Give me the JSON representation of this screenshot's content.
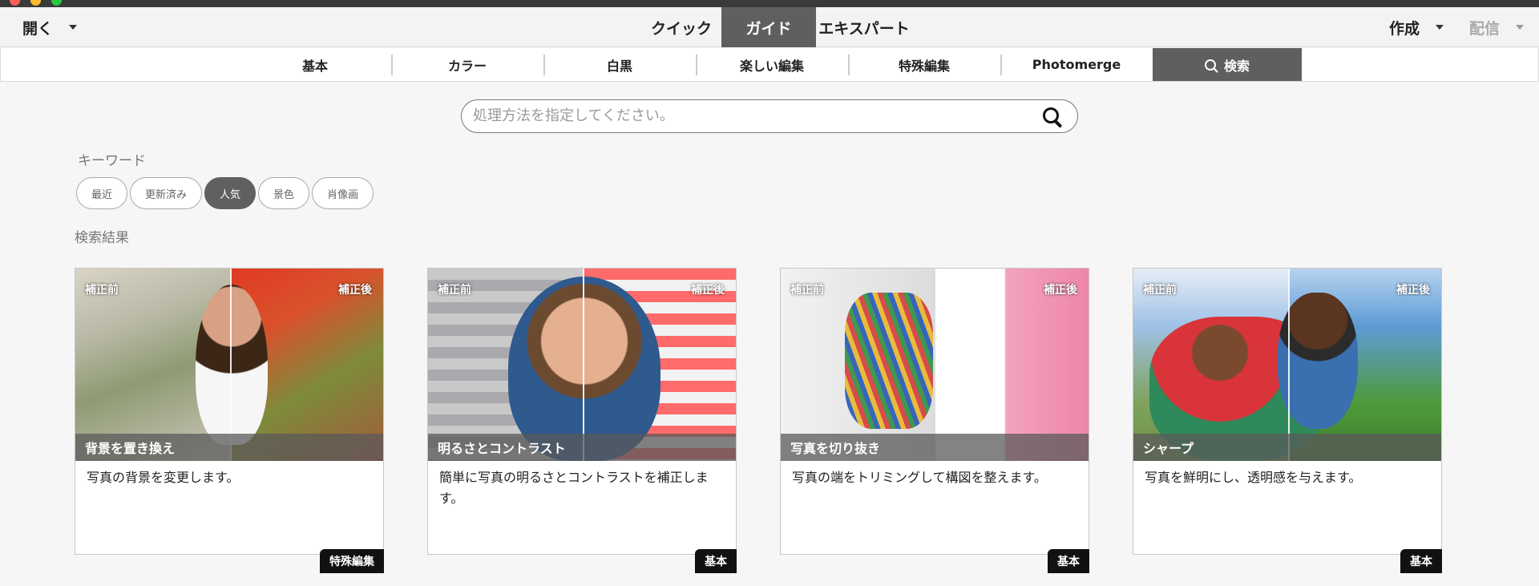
{
  "topbar": {
    "open_label": "開く",
    "modes": [
      "クイック",
      "ガイド",
      "エキスパート"
    ],
    "active_mode": "ガイド",
    "create_label": "作成",
    "share_label": "配信"
  },
  "tabs": {
    "items": [
      "基本",
      "カラー",
      "白黒",
      "楽しい編集",
      "特殊編集",
      "Photomerge"
    ],
    "search_label": "検索",
    "active": "検索"
  },
  "search": {
    "placeholder": "処理方法を指定してください。",
    "value": ""
  },
  "keywords": {
    "label": "キーワード",
    "chips": [
      "最近",
      "更新済み",
      "人気",
      "景色",
      "肖像画"
    ],
    "active_chip": "人気"
  },
  "results": {
    "label": "検索結果",
    "before_tag": "補正前",
    "after_tag": "補正後",
    "cards": [
      {
        "title": "背景を置き換え",
        "description": "写真の背景を変更します。",
        "category": "特殊編集"
      },
      {
        "title": "明るさとコントラスト",
        "description": "簡単に写真の明るさとコントラストを補正します。",
        "category": "基本"
      },
      {
        "title": "写真を切り抜き",
        "description": "写真の端をトリミングして構図を整えます。",
        "category": "基本"
      },
      {
        "title": "シャープ",
        "description": "写真を鮮明にし、透明感を与えます。",
        "category": "基本"
      }
    ]
  },
  "colors": {
    "active_bg": "#5f5f5f",
    "badge_bg": "#111111"
  }
}
